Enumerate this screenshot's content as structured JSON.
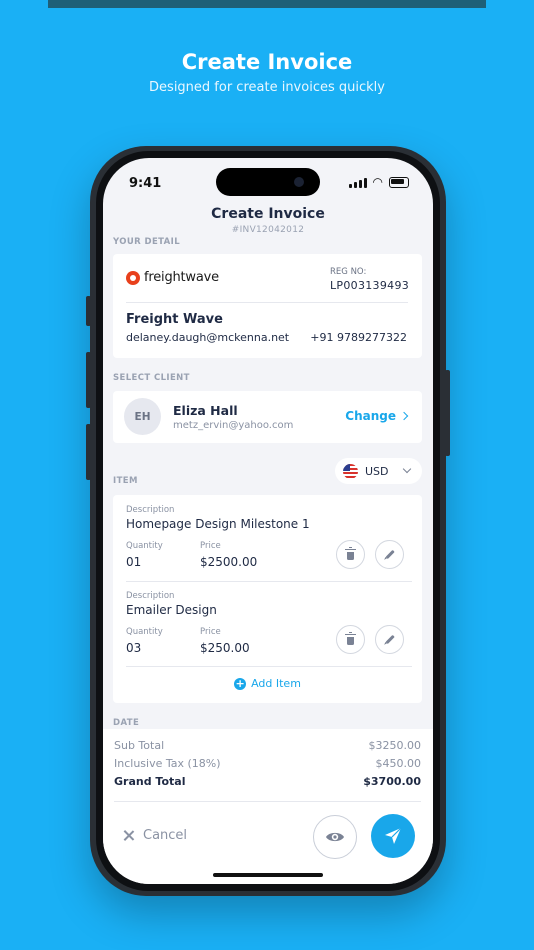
{
  "hero": {
    "title": "Create Invoice",
    "subtitle": "Designed for create invoices quickly"
  },
  "status": {
    "time": "9:41"
  },
  "screen": {
    "title": "Create Invoice",
    "invoice_no": "#INV12042012"
  },
  "your_detail": {
    "section": "YOUR DETAIL",
    "logo_text": "freightwave",
    "reg_label": "REG NO:",
    "reg_no": "LP003139493",
    "business_name": "Freight Wave",
    "email": "delaney.daugh@mckenna.net",
    "phone": "+91 9789277322"
  },
  "client": {
    "section": "SELECT CLIENT",
    "initials": "EH",
    "name": "Eliza Hall",
    "email": "metz_ervin@yahoo.com",
    "change_label": "Change"
  },
  "items": {
    "section": "ITEM",
    "currency": "USD",
    "list": [
      {
        "desc_label": "Description",
        "description": "Homepage Design Milestone 1",
        "qty_label": "Quantity",
        "quantity": "01",
        "price_label": "Price",
        "price": "$2500.00"
      },
      {
        "desc_label": "Description",
        "description": "Emailer Design",
        "qty_label": "Quantity",
        "quantity": "03",
        "price_label": "Price",
        "price": "$250.00"
      }
    ],
    "add_label": "Add Item"
  },
  "date": {
    "section": "DATE"
  },
  "summary": {
    "sub_total_label": "Sub Total",
    "sub_total": "$3250.00",
    "tax_label": "Inclusive Tax (18%)",
    "tax": "$450.00",
    "grand_total_label": "Grand Total",
    "grand_total": "$3700.00"
  },
  "actions": {
    "cancel_label": "Cancel"
  },
  "colors": {
    "background": "#1ab0f5",
    "accent": "#19a7ea",
    "text": "#1f2a44",
    "muted": "#8a92a3",
    "logo": "#e8401c"
  }
}
